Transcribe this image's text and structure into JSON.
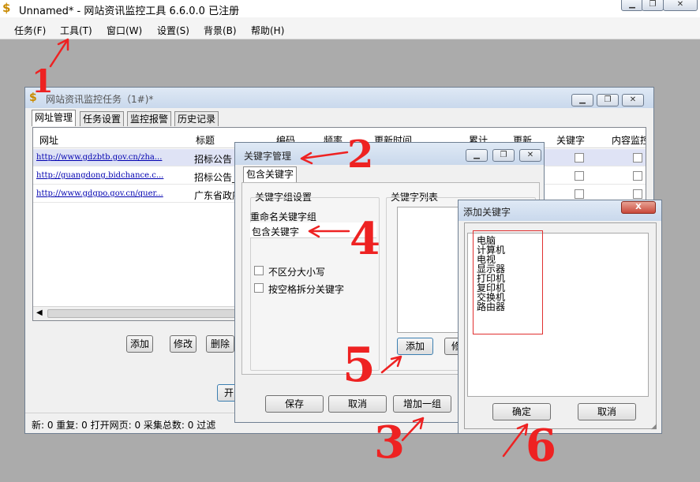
{
  "app": {
    "title": "Unnamed* - 网站资讯监控工具 6.6.0.0  已注册",
    "menu": [
      "任务(F)",
      "工具(T)",
      "窗口(W)",
      "设置(S)",
      "背景(B)",
      "帮助(H)"
    ]
  },
  "task_window": {
    "title": "网站资讯监控任务（1#)*",
    "tabs": [
      "网址管理",
      "任务设置",
      "监控报警",
      "历史记录"
    ],
    "columns": [
      "网址",
      "标题",
      "编码",
      "频率",
      "更新时间",
      "累计",
      "更新",
      "关键字",
      "内容监控"
    ],
    "rows": [
      {
        "url": "http://www.gdzbtb.gov.cn/zha...",
        "title": "招标公告"
      },
      {
        "url": "http://guangdong.bidchance.c...",
        "title": "招标公告_"
      },
      {
        "url": "http://www.gdgpo.gov.cn/quer...",
        "title": "广东省政府"
      }
    ],
    "buttons": {
      "add": "添加",
      "edit": "修改",
      "delete": "删除",
      "start": "开"
    },
    "status": "新: 0  重复: 0  打开网页: 0  采集总数: 0  过滤"
  },
  "keyword_manager": {
    "title": "关键字管理",
    "tab": "包含关键字",
    "group_settings_label": "关键字组设置",
    "rename_label": "重命名关键字组",
    "rename_value": "包含关键字",
    "case_insensitive_label": "不区分大小写",
    "split_by_space_label": "按空格拆分关键字",
    "keyword_list_label": "关键字列表",
    "add_button": "添加",
    "edit_button": "修",
    "save_button": "保存",
    "cancel_button": "取消",
    "add_group_button": "增加一组"
  },
  "add_keyword_dialog": {
    "title": "添加关键字",
    "close": "X",
    "keywords": [
      "电脑",
      "计算机",
      "电视",
      "显示器",
      "打印机",
      "复印机",
      "交换机",
      "路由器"
    ],
    "ok_button": "确定",
    "cancel_button": "取消"
  },
  "annotations": [
    "1",
    "2",
    "3",
    "4",
    "5",
    "6"
  ],
  "colors": {
    "annotation": "#ee2222",
    "link": "#0000b0",
    "selected_row": "#dfe3f5"
  }
}
